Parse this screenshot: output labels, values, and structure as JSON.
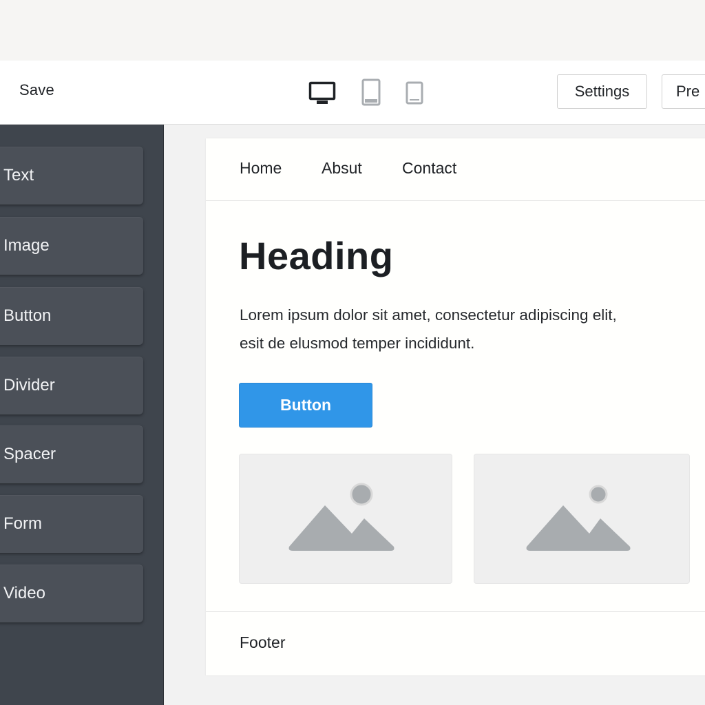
{
  "toolbar": {
    "save_label": "Save",
    "devices": [
      {
        "name": "desktop",
        "icon": "desktop-icon",
        "active": true
      },
      {
        "name": "tablet",
        "icon": "tablet-icon",
        "active": false
      },
      {
        "name": "mobile",
        "icon": "mobile-icon",
        "active": false
      }
    ],
    "settings_label": "Settings",
    "preview_label": "Pre"
  },
  "sidebar": {
    "items": [
      {
        "label": "Text"
      },
      {
        "label": "Image"
      },
      {
        "label": "Button"
      },
      {
        "label": "Divider"
      },
      {
        "label": "Spacer"
      },
      {
        "label": "Form"
      },
      {
        "label": "Video"
      }
    ]
  },
  "page": {
    "nav": [
      "Home",
      "Absut",
      "Contact"
    ],
    "heading": "Heading",
    "body_line1": "Lorem ipsum dolor sit amet, consectetur adipiscing elit,",
    "body_line2": "esit de elusmod temper incididunt.",
    "button_label": "Button",
    "image_placeholders": [
      "image-placeholder-icon",
      "image-placeholder-icon"
    ],
    "footer": "Footer"
  },
  "colors": {
    "sidebar_bg": "#3f454d",
    "sidebar_item": "#4b5058",
    "accent_button": "#3096e8",
    "device_active": "#1f2226",
    "device_inactive": "#a9adb1",
    "placeholder_bg": "#efefef",
    "placeholder_icon": "#a8acaf"
  }
}
